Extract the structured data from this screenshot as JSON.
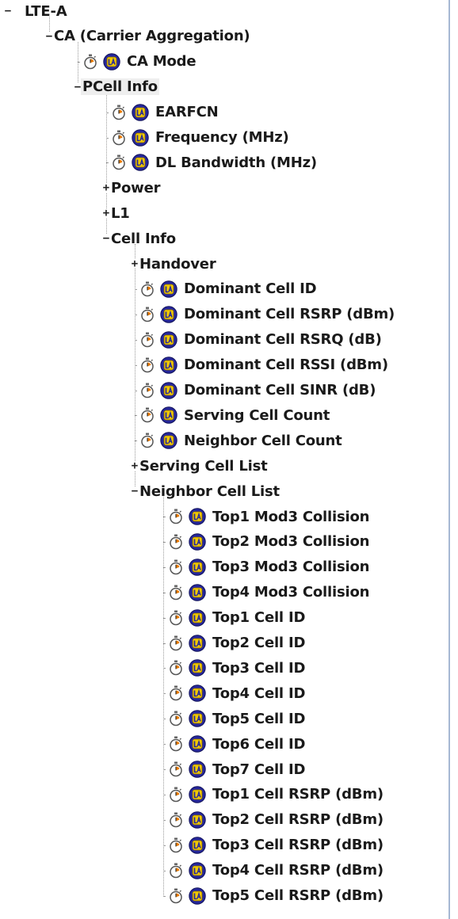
{
  "colors": {
    "background": "#ffffff",
    "text": "#1a1a1a",
    "tree_line": "#9a9a9a",
    "icon_blue": "#26279c",
    "icon_gold": "#f0c800",
    "panel_border": "#a6b8d3"
  },
  "icons": {
    "leaf_timer": "stopwatch-icon",
    "leaf_badge": "la-badge-icon",
    "expanded": "minus",
    "collapsed": "plus"
  },
  "nodes": [
    {
      "label": "LTE-A",
      "level": 0,
      "type": "branch",
      "expanded": true
    },
    {
      "label": "CA (Carrier Aggregation)",
      "level": 1,
      "type": "branch",
      "expanded": true
    },
    {
      "label": "CA Mode",
      "level": 2,
      "type": "leaf"
    },
    {
      "label": "PCell Info",
      "level": 2,
      "type": "branch",
      "expanded": true,
      "selected": true
    },
    {
      "label": "EARFCN",
      "level": 3,
      "type": "leaf"
    },
    {
      "label": "Frequency (MHz)",
      "level": 3,
      "type": "leaf"
    },
    {
      "label": "DL Bandwidth (MHz)",
      "level": 3,
      "type": "leaf"
    },
    {
      "label": "Power",
      "level": 3,
      "type": "branch",
      "expanded": false
    },
    {
      "label": "L1",
      "level": 3,
      "type": "branch",
      "expanded": false
    },
    {
      "label": "Cell Info",
      "level": 3,
      "type": "branch",
      "expanded": true
    },
    {
      "label": "Handover",
      "level": 4,
      "type": "branch",
      "expanded": false
    },
    {
      "label": "Dominant Cell ID",
      "level": 4,
      "type": "leaf"
    },
    {
      "label": "Dominant Cell RSRP (dBm)",
      "level": 4,
      "type": "leaf"
    },
    {
      "label": "Dominant Cell RSRQ (dB)",
      "level": 4,
      "type": "leaf"
    },
    {
      "label": "Dominant Cell RSSI (dBm)",
      "level": 4,
      "type": "leaf"
    },
    {
      "label": "Dominant Cell SINR (dB)",
      "level": 4,
      "type": "leaf"
    },
    {
      "label": "Serving Cell Count",
      "level": 4,
      "type": "leaf"
    },
    {
      "label": "Neighbor Cell Count",
      "level": 4,
      "type": "leaf"
    },
    {
      "label": "Serving Cell List",
      "level": 4,
      "type": "branch",
      "expanded": false
    },
    {
      "label": "Neighbor Cell List",
      "level": 4,
      "type": "branch",
      "expanded": true
    },
    {
      "label": "Top1 Mod3 Collision",
      "level": 5,
      "type": "leaf"
    },
    {
      "label": "Top2 Mod3 Collision",
      "level": 5,
      "type": "leaf"
    },
    {
      "label": "Top3 Mod3 Collision",
      "level": 5,
      "type": "leaf"
    },
    {
      "label": "Top4 Mod3 Collision",
      "level": 5,
      "type": "leaf"
    },
    {
      "label": "Top1 Cell ID",
      "level": 5,
      "type": "leaf"
    },
    {
      "label": "Top2 Cell ID",
      "level": 5,
      "type": "leaf"
    },
    {
      "label": "Top3 Cell ID",
      "level": 5,
      "type": "leaf"
    },
    {
      "label": "Top4 Cell ID",
      "level": 5,
      "type": "leaf"
    },
    {
      "label": "Top5 Cell ID",
      "level": 5,
      "type": "leaf"
    },
    {
      "label": "Top6 Cell ID",
      "level": 5,
      "type": "leaf"
    },
    {
      "label": "Top7 Cell ID",
      "level": 5,
      "type": "leaf"
    },
    {
      "label": "Top1 Cell RSRP (dBm)",
      "level": 5,
      "type": "leaf"
    },
    {
      "label": "Top2 Cell RSRP (dBm)",
      "level": 5,
      "type": "leaf"
    },
    {
      "label": "Top3 Cell RSRP (dBm)",
      "level": 5,
      "type": "leaf"
    },
    {
      "label": "Top4 Cell RSRP (dBm)",
      "level": 5,
      "type": "leaf"
    },
    {
      "label": "Top5 Cell RSRP (dBm)",
      "level": 5,
      "type": "leaf"
    }
  ]
}
